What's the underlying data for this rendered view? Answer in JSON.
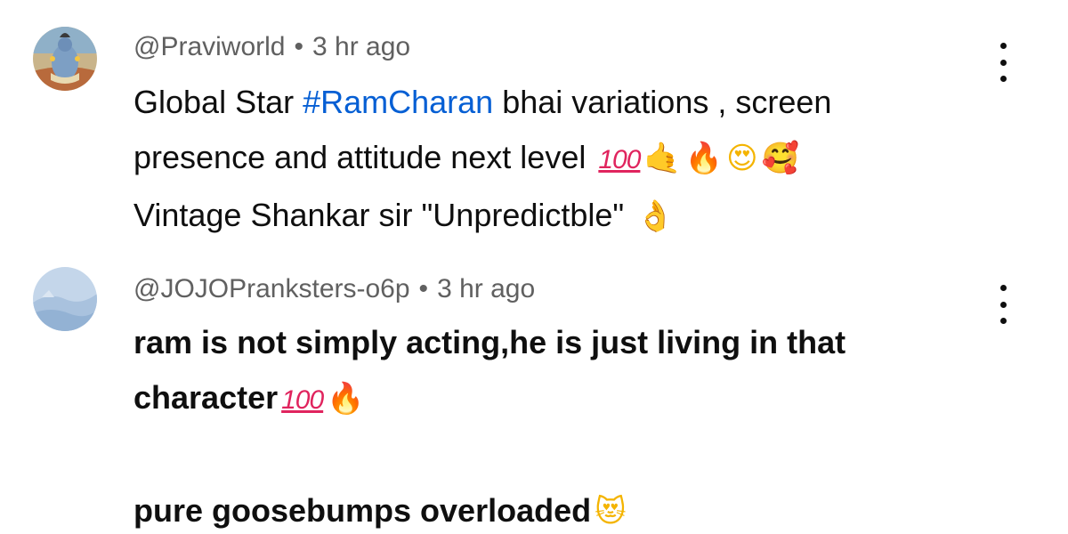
{
  "comments": [
    {
      "author": "@Praviworld",
      "separator": "•",
      "time": "3 hr ago",
      "avatar_icon": "deity-avatar-icon",
      "lines": {
        "l1_a": "Global Star ",
        "l1_hashtag": "#RamCharan",
        "l1_b": " bhai variations , screen",
        "l2_text": "presence and attitude next level ",
        "l2_emojis": {
          "hundred": "100",
          "call_me_hand": "🤙",
          "fire": "🔥",
          "heart_eyes": "😍",
          "smiling_hearts": "🥰"
        },
        "l3_text": "Vintage Shankar sir \"Unpredictble\" ",
        "l3_emojis": {
          "ok_hand": "👌"
        }
      }
    },
    {
      "author": "@JOJOPranksters-o6p",
      "separator": "•",
      "time": "3 hr ago",
      "avatar_icon": "blue-landscape-avatar-icon",
      "lines": {
        "l1_text": "ram is not simply acting,he is just living in that",
        "l2_text": "character",
        "l2_emojis": {
          "hundred": "100",
          "fire": "🔥"
        },
        "l4_text": "pure goosebumps overloaded",
        "l4_emojis": {
          "heart_eyes_cat": "😻"
        }
      }
    }
  ],
  "menu_icon": "more-vertical-icon",
  "colors": {
    "hashtag": "#065fd4",
    "meta": "#606060",
    "text": "#0f0f0f",
    "hundred": "#e0245e"
  }
}
